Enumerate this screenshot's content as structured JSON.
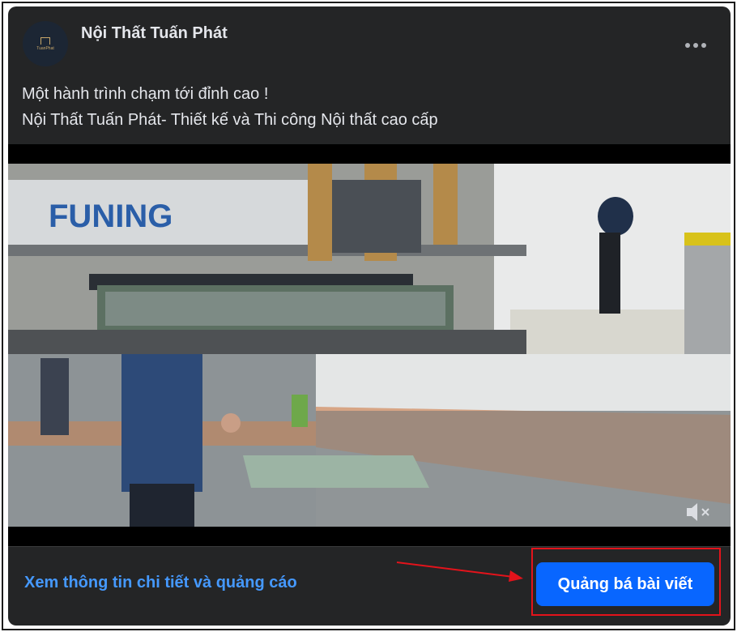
{
  "post": {
    "page_name": "Nội Thất Tuấn Phát",
    "more_icon": "more-horizontal-icon",
    "caption_lines": [
      "Một hành trình chạm tới đỉnh cao !",
      "Nội Thất Tuấn Phát- Thiết kế và Thi công Nội thất cao cấp"
    ],
    "video": {
      "machine_brand_text": "FUNING",
      "mute_icon": "speaker-muted-icon"
    }
  },
  "footer": {
    "insights_link": "Xem thông tin chi tiết và quảng cáo",
    "boost_button": "Quảng bá bài viết"
  },
  "annotation": {
    "highlight_color": "#e3131b"
  },
  "colors": {
    "card_bg": "#242526",
    "link": "#4599ff",
    "primary_button": "#0866ff"
  }
}
